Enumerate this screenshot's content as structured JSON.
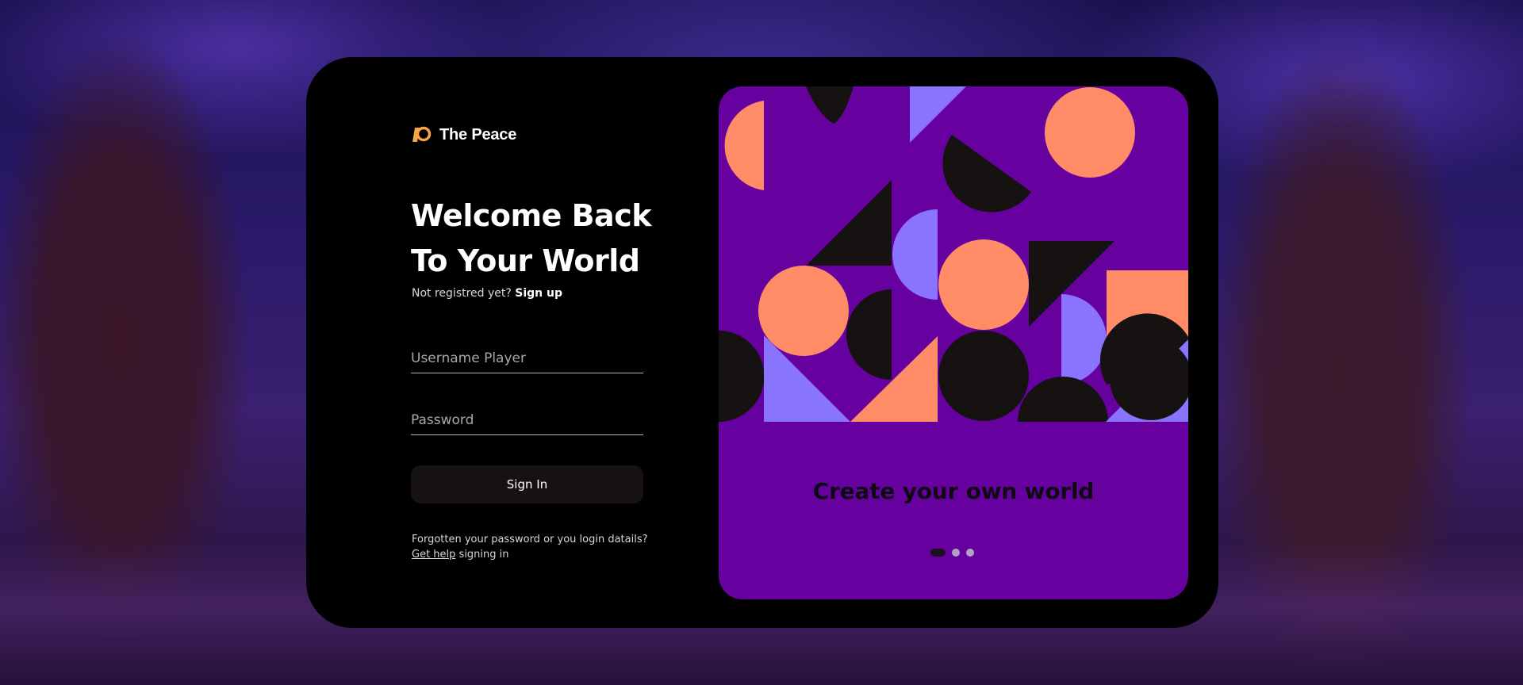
{
  "app": {
    "logo_icon": "the-peace-logo-icon",
    "logo_text": "The Peace"
  },
  "login": {
    "heading_line1": "Welcome Back",
    "heading_line2": "To Your World",
    "signup_prompt": "Not registred yet?",
    "signup_link": "Sign up",
    "username_placeholder": "Username Player",
    "password_placeholder": "Password",
    "signin_label": "Sign In",
    "help_text": "Forgotten your password or you login datails?",
    "help_link": "Get help",
    "help_suffix": "signing in"
  },
  "carousel": {
    "title": "Create your own world",
    "active_index": 0,
    "slide_count": 3
  },
  "colors": {
    "panel": "#6601a0",
    "accent_orange": "#ff8c66",
    "accent_violet": "#8a73ff",
    "logo_orange": "#f7a541",
    "card": "#000000"
  }
}
